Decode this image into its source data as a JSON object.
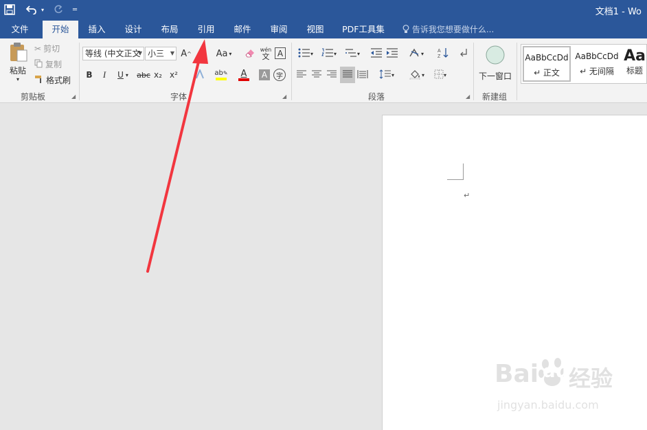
{
  "window": {
    "title": "文档1 - Wo"
  },
  "qat": {
    "save_icon": "save-icon",
    "undo_icon": "undo-icon",
    "redo_icon": "redo-icon",
    "customize_icon": "customize-qat-icon"
  },
  "tabs": [
    {
      "label": "文件"
    },
    {
      "label": "开始",
      "active": true
    },
    {
      "label": "插入"
    },
    {
      "label": "设计"
    },
    {
      "label": "布局"
    },
    {
      "label": "引用"
    },
    {
      "label": "邮件"
    },
    {
      "label": "审阅"
    },
    {
      "label": "视图"
    },
    {
      "label": "PDF工具集"
    }
  ],
  "tell_me": {
    "text": "告诉我您想要做什么...",
    "icon": "lightbulb-icon"
  },
  "clipboard": {
    "paste": "粘贴",
    "cut": "剪切",
    "copy": "复制",
    "format_painter": "格式刷",
    "label": "剪贴板"
  },
  "font": {
    "font_name": "等线 (中文正文",
    "font_size": "小三",
    "label": "字体",
    "bold": "B",
    "italic": "I",
    "underline": "U",
    "strike": "abc",
    "subscript": "x₂",
    "superscript": "x²",
    "change_case": "Aa",
    "grow": "A",
    "phonetic_top": "wén",
    "phonetic_bottom": "文",
    "char_border": "A",
    "font_color": "A",
    "char_shading": "A",
    "enclose": "字"
  },
  "paragraph": {
    "label": "段落"
  },
  "new_group": {
    "new_window": "下一窗口",
    "label": "新建组"
  },
  "styles": [
    {
      "sample": "AaBbCcDd",
      "name": "↵ 正文",
      "selected": true
    },
    {
      "sample": "AaBbCcDd",
      "name": "↵ 无间隔"
    },
    {
      "sample": "Aa",
      "name": "标题"
    }
  ],
  "document": {
    "paragraph_mark": "↵"
  },
  "colors": {
    "accent": "#2b579a",
    "arrow": "#f2363f",
    "highlight": "#ffff00",
    "font_color": "#e00000"
  },
  "watermark": {
    "brand": "Bai",
    "brand2": "du",
    "cn": "经验",
    "url": "jingyan.baidu.com"
  }
}
